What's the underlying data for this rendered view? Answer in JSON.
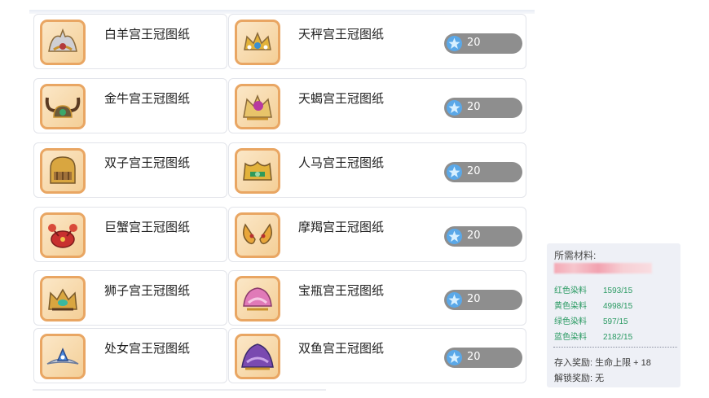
{
  "cards": [
    {
      "name": "白羊宫王冠图纸",
      "icon": "aries-crown-icon"
    },
    {
      "name": "天秤宫王冠图纸",
      "icon": "libra-crown-icon",
      "price": "20"
    },
    {
      "name": "金牛宫王冠图纸",
      "icon": "taurus-crown-icon"
    },
    {
      "name": "天蝎宫王冠图纸",
      "icon": "scorpio-crown-icon",
      "price": "20"
    },
    {
      "name": "双子宫王冠图纸",
      "icon": "gemini-crown-icon"
    },
    {
      "name": "人马宫王冠图纸",
      "icon": "sagittarius-crown-icon",
      "price": "20"
    },
    {
      "name": "巨蟹宫王冠图纸",
      "icon": "cancer-crown-icon"
    },
    {
      "name": "摩羯宫王冠图纸",
      "icon": "capricorn-crown-icon",
      "price": "20"
    },
    {
      "name": "狮子宫王冠图纸",
      "icon": "leo-crown-icon"
    },
    {
      "name": "宝瓶宫王冠图纸",
      "icon": "aquarius-crown-icon",
      "price": "20"
    },
    {
      "name": "处女宫王冠图纸",
      "icon": "virgo-crown-icon"
    },
    {
      "name": "双鱼宫王冠图纸",
      "icon": "pisces-crown-icon",
      "price": "20"
    }
  ],
  "currency_icon": "star-gem-icon",
  "materials": {
    "title": "所需材料:",
    "dyes": [
      {
        "name": "红色染料",
        "amount": "1593/15"
      },
      {
        "name": "黄色染料",
        "amount": "4998/15"
      },
      {
        "name": "绿色染料",
        "amount": "597/15"
      },
      {
        "name": "蓝色染料",
        "amount": "2182/15"
      }
    ],
    "store_reward_label": "存入奖励:",
    "store_reward_value": "生命上限 + 18",
    "unlock_reward_label": "解锁奖励:",
    "unlock_reward_value": "无"
  },
  "colors": {
    "thumb_border": "#e9a663",
    "price_pill": "#8e8e8e",
    "dye_text": "#2a9a62",
    "panel_bg": "#eef0f6"
  }
}
